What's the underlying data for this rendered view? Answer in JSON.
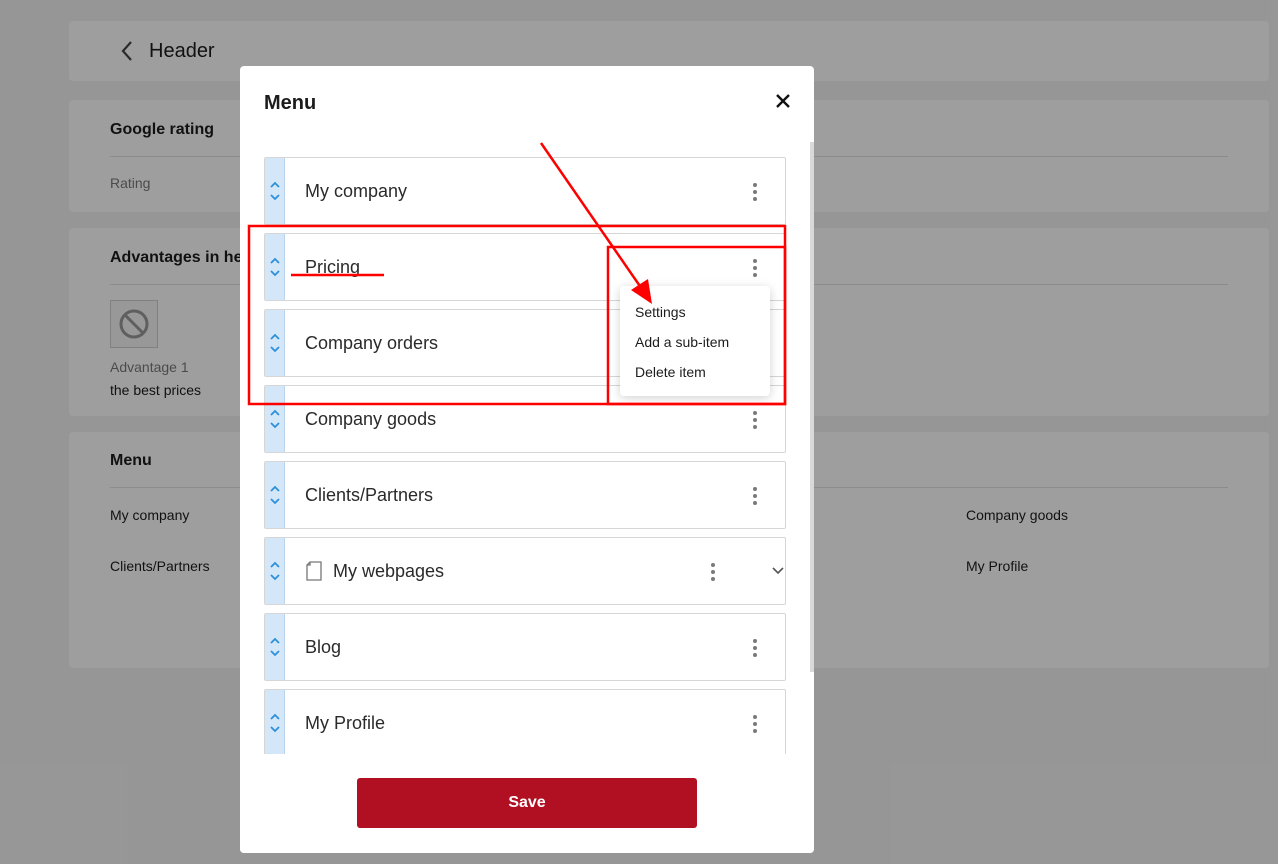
{
  "background": {
    "header_title": "Header",
    "google_rating": {
      "title": "Google rating",
      "rating_label": "Rating"
    },
    "advantages": {
      "title": "Advantages in he",
      "advantage_label": "Advantage 1",
      "advantage_text": "the best prices"
    },
    "menu": {
      "title": "Menu",
      "links": [
        "My company",
        "Clients/Partners",
        "Company goods",
        "My Profile"
      ]
    }
  },
  "modal": {
    "title": "Menu",
    "items": [
      {
        "label": "My company"
      },
      {
        "label": "Pricing"
      },
      {
        "label": "Company orders"
      },
      {
        "label": "Company goods"
      },
      {
        "label": "Clients/Partners"
      },
      {
        "label": "My webpages"
      },
      {
        "label": "Blog"
      },
      {
        "label": "My Profile"
      }
    ],
    "context_menu": [
      "Settings",
      "Add a sub-item",
      "Delete item"
    ],
    "save_label": "Save"
  },
  "colors": {
    "accent": "#b11022",
    "drag_handle": "#d3e7f8",
    "drag_arrows": "#2e8fd8",
    "annotation": "#ff0000"
  },
  "icons": [
    "chevron-left-icon",
    "close-icon",
    "drag-handle-icon",
    "more-vertical-icon",
    "page-icon",
    "chevron-down-icon",
    "no-image-icon"
  ]
}
